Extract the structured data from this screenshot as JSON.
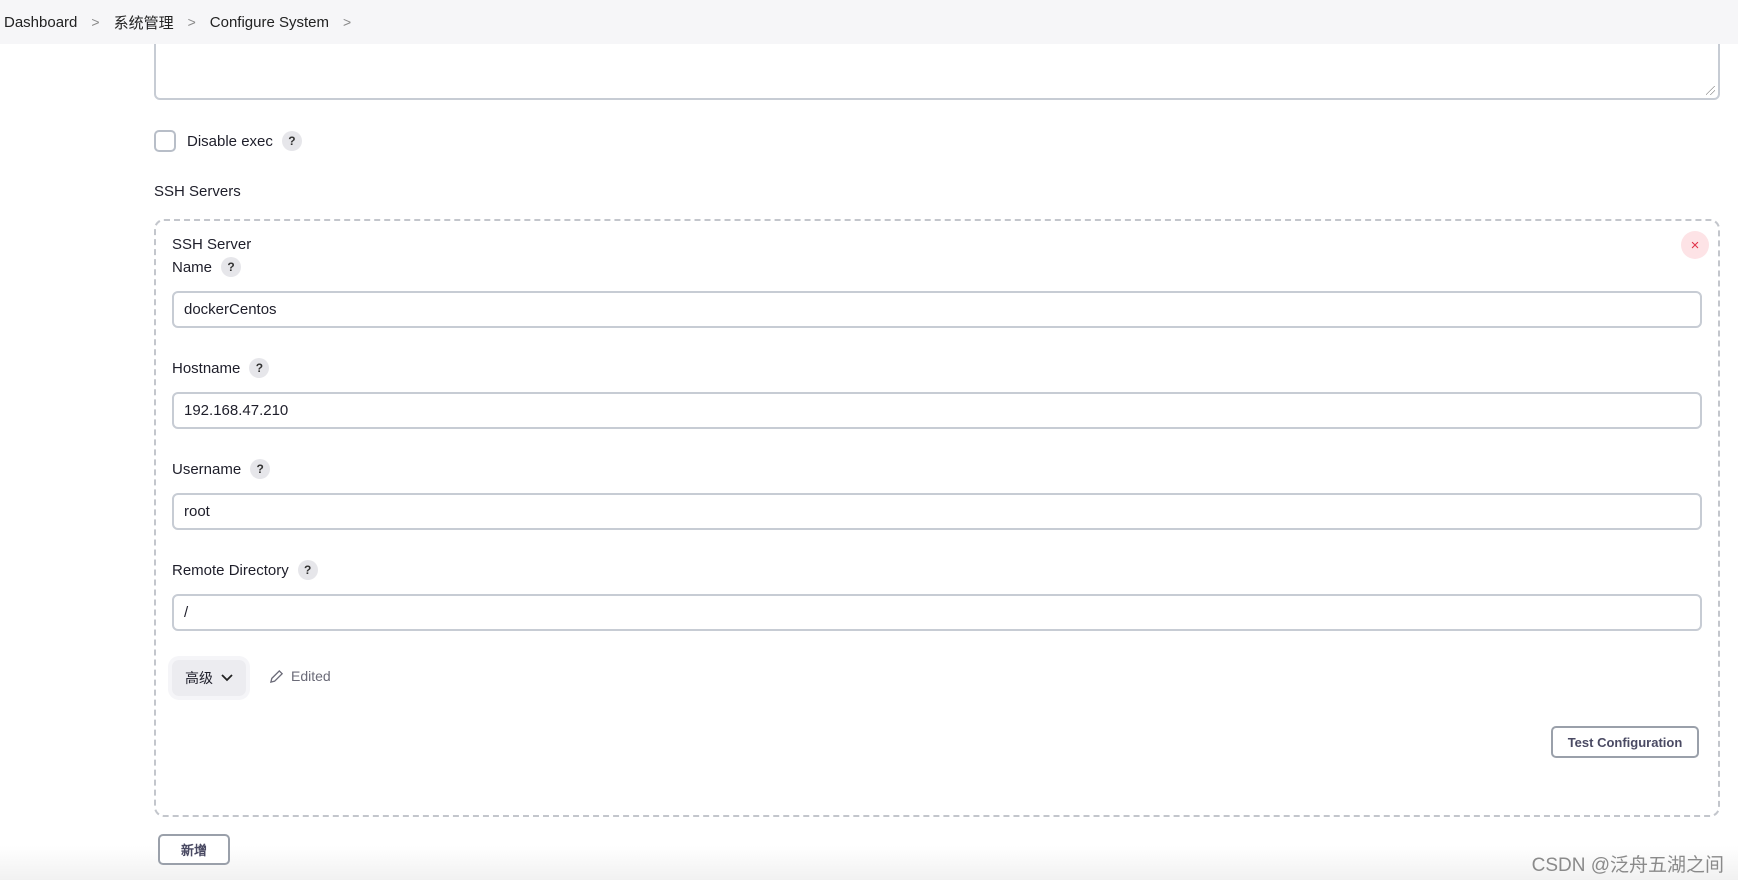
{
  "breadcrumb": [
    "Dashboard",
    "系统管理",
    "Configure System"
  ],
  "disable_exec": {
    "label": "Disable exec",
    "checked": false
  },
  "section_title": "SSH Servers",
  "server": {
    "title": "SSH Server",
    "fields": [
      {
        "label": "Name",
        "value": "dockerCentos"
      },
      {
        "label": "Hostname",
        "value": "192.168.47.210"
      },
      {
        "label": "Username",
        "value": "root"
      },
      {
        "label": "Remote Directory",
        "value": "/"
      }
    ],
    "advanced_label": "高级",
    "edited_label": "Edited",
    "test_button": "Test Configuration"
  },
  "add_button": "新增",
  "help_glyph": "?",
  "close_glyph": "×",
  "watermark": "CSDN @泛舟五湖之间"
}
